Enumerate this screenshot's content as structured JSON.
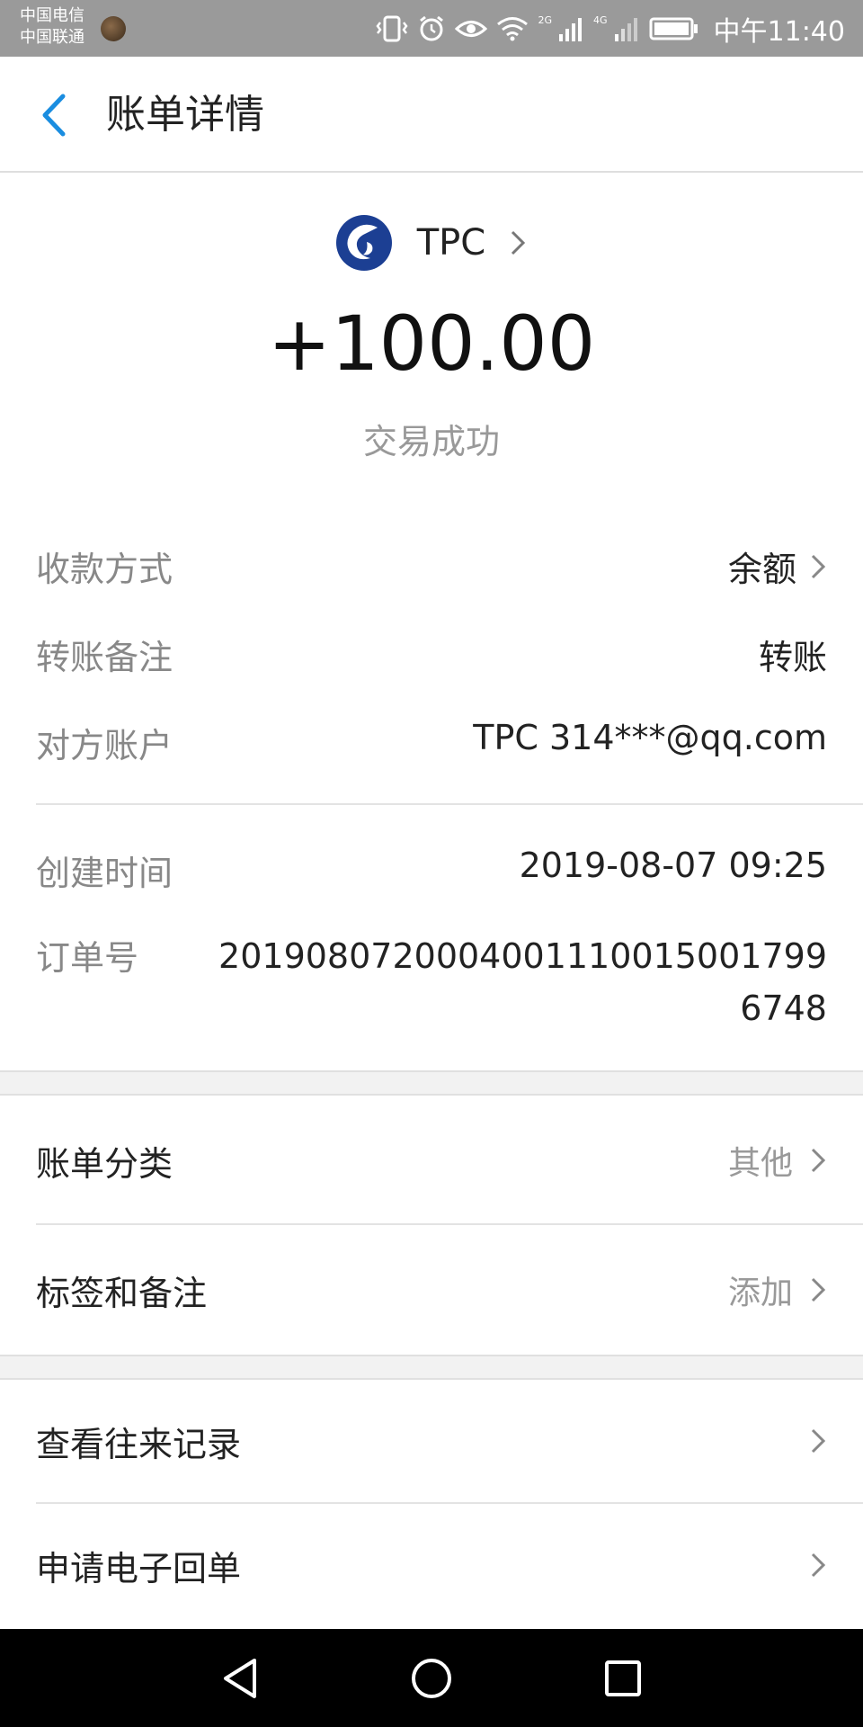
{
  "status_bar": {
    "carrier1": "中国电信",
    "carrier2": "中国联通",
    "net1": "2G",
    "net2": "4G",
    "time": "中午11:40"
  },
  "header": {
    "title": "账单详情"
  },
  "summary": {
    "payee": "TPC",
    "amount": "+100.00",
    "status": "交易成功"
  },
  "details": [
    {
      "label": "收款方式",
      "value": "余额"
    },
    {
      "label": "转账备注",
      "value": "转账"
    },
    {
      "label": "对方账户",
      "value": "TPC 314***@qq.com"
    },
    {
      "label": "创建时间",
      "value": "2019-08-07 09:25"
    },
    {
      "label": "订单号",
      "value": "2019080720004001110015001799674‌8"
    }
  ],
  "menu": [
    {
      "label": "账单分类",
      "value": "其他"
    },
    {
      "label": "标签和备注",
      "value": "添加"
    },
    {
      "label": "查看往来记录",
      "value": ""
    },
    {
      "label": "申请电子回单",
      "value": ""
    }
  ],
  "colors": {
    "accent": "#1a8de0",
    "logo": "#1c3f93"
  }
}
